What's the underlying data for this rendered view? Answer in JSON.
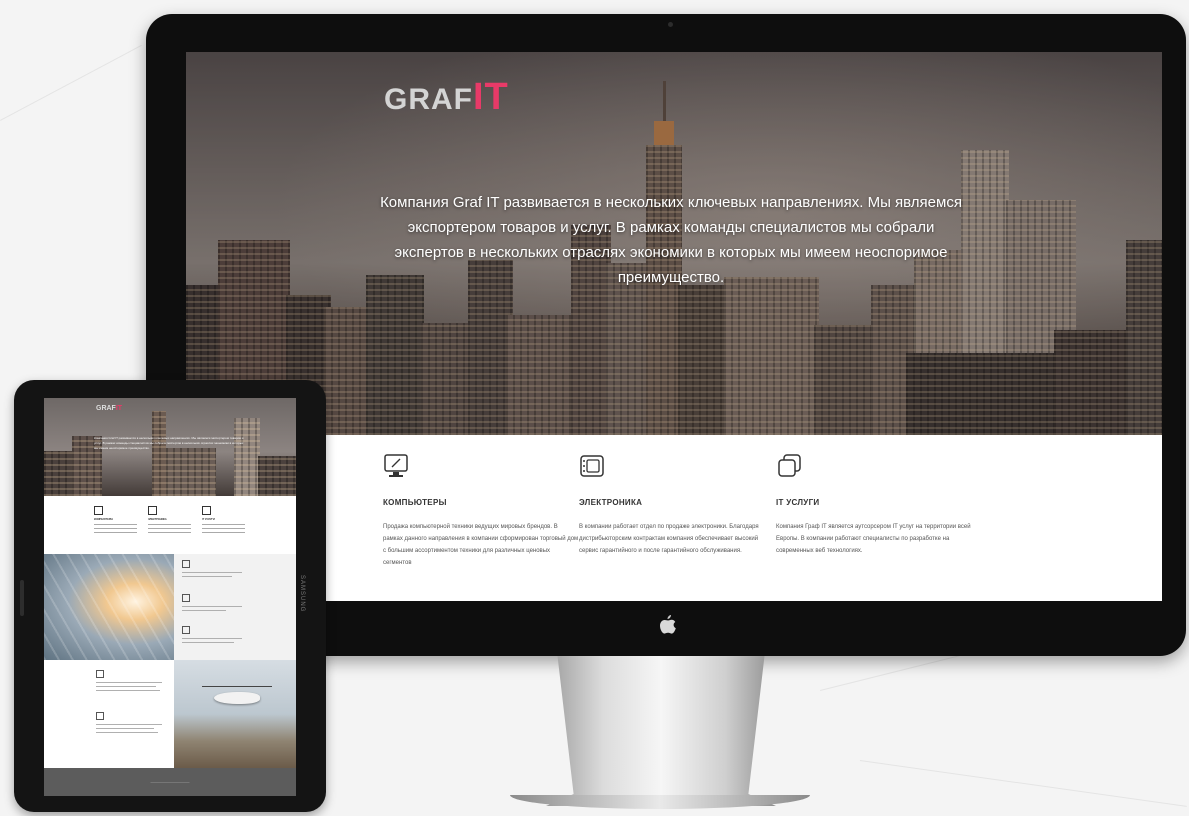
{
  "brand": {
    "logo_part1": "GRAF",
    "logo_part2": "IT",
    "accent_color": "#e83a68"
  },
  "hero": {
    "text": "Компания Graf IT  развивается в нескольких ключевых направлениях. Мы являемся экспортером товаров и услуг. В рамках команды специалистов мы собрали экспертов в нескольких отраслях экономики в которых мы имеем неоспоримое преимущество."
  },
  "services": [
    {
      "icon": "computer-icon",
      "title": "КОМПЬЮТЕРЫ",
      "text": "Продажа компьютерной техники ведущих мировых брендов. В рамках данного направления в компании сформирован торговый дом с большим ассортиментом техники для различных ценовых сегментов"
    },
    {
      "icon": "electronics-icon",
      "title": "ЭЛЕКТРОНИКА",
      "text": "В компании работает отдел по продаже электроники. Благодаря дистрибьюторским контрактам компания обеспечивает высокий сервис гарантийного и после гарантийного обслуживания."
    },
    {
      "icon": "it-services-icon",
      "title": "IT УСЛУГИ",
      "text": "Компания Граф IT является аутсорсером IT услуг на территории всей Европы. В компании работают специалисты по разработке на современных веб технологиях."
    }
  ],
  "tablet": {
    "brand_label": "SAMSUNG"
  }
}
